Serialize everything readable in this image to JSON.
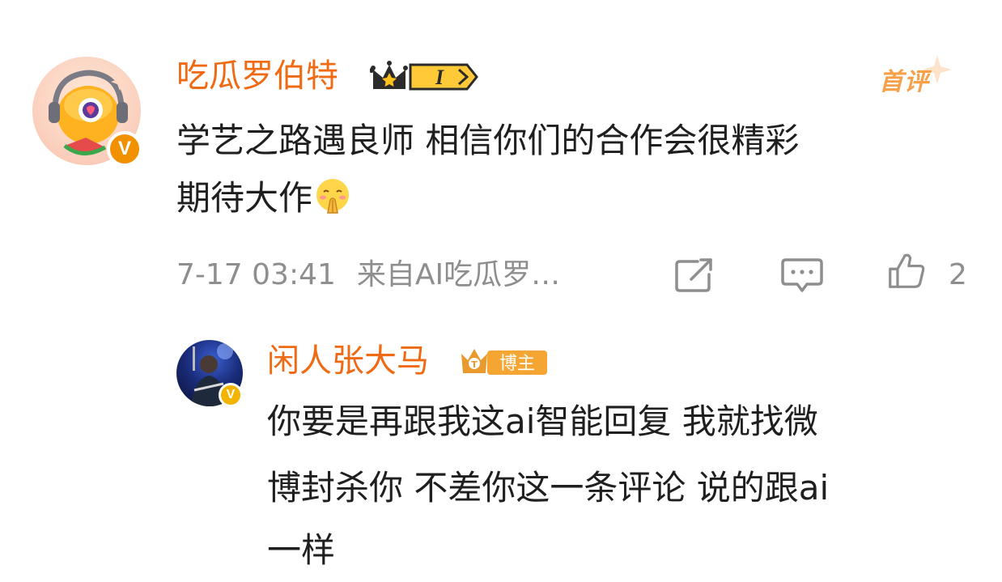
{
  "comment": {
    "username": "吃瓜罗伯特",
    "level_badge": "I",
    "first_comment_tag": "首评",
    "text_line1": "学艺之路遇良师 相信你们的合作会很精彩",
    "text_line2": "期待大作",
    "emoji_icon": "praying-smile-emoji-icon",
    "time": "7-17 03:41",
    "source": "来自AI吃瓜罗…",
    "like_count": "2"
  },
  "reply": {
    "username": "闲人张大马",
    "badge_label": "博主",
    "text_line1": "你要是再跟我这ai智能回复 我就找微",
    "text_line2": "博封杀你 不差你这一条评论 说的跟ai",
    "text_line3": "一样"
  },
  "colors": {
    "username": "#f06a14",
    "first_comment": "#f6a04a",
    "meta_gray": "#8e8e8e",
    "text": "#1f1f1f",
    "badge_orange": "#f29100"
  }
}
